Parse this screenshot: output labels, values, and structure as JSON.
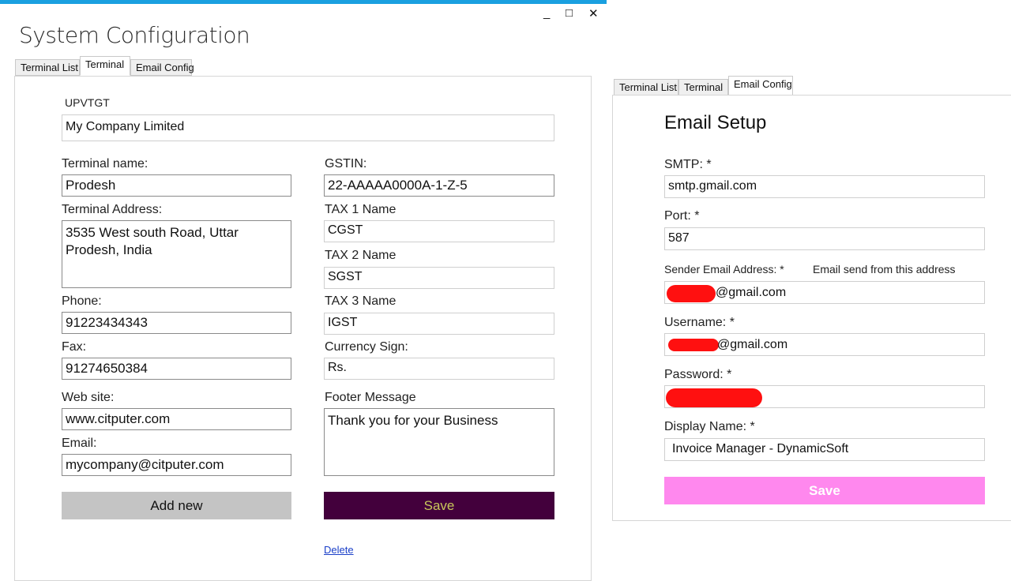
{
  "window": {
    "title": "System Configuration",
    "minimize": "_",
    "maximize": "□",
    "close": "✕"
  },
  "left": {
    "tabs": [
      "Terminal List",
      "Terminal",
      "Email Config"
    ],
    "active_tab": "Terminal",
    "code": "UPVTGT",
    "company_name": "My Company Limited",
    "fields": {
      "terminal_name_label": "Terminal name:",
      "terminal_name": "Prodesh",
      "terminal_address_label": "Terminal Address:",
      "terminal_address": "3535 West south Road, Uttar Prodesh, India",
      "phone_label": "Phone:",
      "phone": "91223434343",
      "fax_label": "Fax:",
      "fax": "91274650384",
      "website_label": "Web site:",
      "website": "www.citputer.com",
      "email_label": "Email:",
      "email": "mycompany@citputer.com",
      "gstin_label": "GSTIN:",
      "gstin": "22-AAAAA0000A-1-Z-5",
      "tax1_label": "TAX 1 Name",
      "tax1": "CGST",
      "tax2_label": "TAX 2 Name",
      "tax2": "SGST",
      "tax3_label": "TAX 3 Name",
      "tax3": "IGST",
      "currency_label": "Currency Sign:",
      "currency": "Rs.",
      "footer_label": "Footer Message",
      "footer": "Thank you for your Business"
    },
    "add_new_label": "Add new",
    "save_label": "Save",
    "delete_label": "Delete",
    "colors": {
      "save_bg": "#43003c",
      "save_text": "#c8c85a",
      "add_bg": "#c4c4c4"
    }
  },
  "right": {
    "tabs": [
      "Terminal List",
      "Terminal",
      "Email Config"
    ],
    "active_tab": "Email Config",
    "heading": "Email Setup",
    "smtp_label": "SMTP: *",
    "smtp": "smtp.gmail.com",
    "port_label": "Port: *",
    "port": "587",
    "sender_label": "Sender Email Address: *",
    "sender_hint": "Email send from this address",
    "sender_suffix": "@gmail.com",
    "username_label": "Username: *",
    "username_suffix": "@gmail.com",
    "password_label": "Password: *",
    "display_label": "Display Name:  *",
    "display": "Invoice Manager  - DynamicSoft",
    "save_label": "Save",
    "colors": {
      "save_bg": "#ff88ee",
      "save_text": "#ffffff",
      "redaction": "#ff1010"
    }
  }
}
